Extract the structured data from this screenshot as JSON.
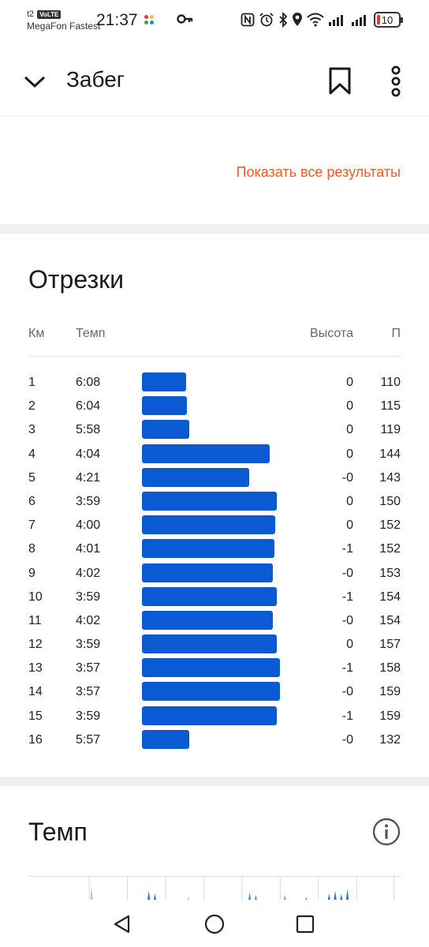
{
  "status_bar": {
    "carrier_top": "t2",
    "volte": "VoLTE",
    "carrier_bottom": "MegaFon Fastest",
    "time": "21:37",
    "battery": "10",
    "icons": [
      "nfc-icon",
      "alarm-icon",
      "bluetooth-icon",
      "location-icon",
      "wifi-icon",
      "signal-icon",
      "signal-icon",
      "battery-icon"
    ]
  },
  "header": {
    "title": "Забег",
    "icons": [
      "chevron-down-icon",
      "bookmark-icon",
      "more-vertical-icon"
    ]
  },
  "results": {
    "show_all_label": "Показать все результаты"
  },
  "splits": {
    "title": "Отрезки",
    "columns": {
      "km": "Км",
      "pace": "Темп",
      "elevation": "Высота",
      "hr": "П"
    },
    "max_bar_fraction_reference_pace_seconds": 237,
    "rows": [
      {
        "km": "1",
        "pace": "6:08",
        "elevation": "0",
        "hr": "110"
      },
      {
        "km": "2",
        "pace": "6:04",
        "elevation": "0",
        "hr": "115"
      },
      {
        "km": "3",
        "pace": "5:58",
        "elevation": "0",
        "hr": "119"
      },
      {
        "km": "4",
        "pace": "4:04",
        "elevation": "0",
        "hr": "144"
      },
      {
        "km": "5",
        "pace": "4:21",
        "elevation": "-0",
        "hr": "143"
      },
      {
        "km": "6",
        "pace": "3:59",
        "elevation": "0",
        "hr": "150"
      },
      {
        "km": "7",
        "pace": "4:00",
        "elevation": "0",
        "hr": "152"
      },
      {
        "km": "8",
        "pace": "4:01",
        "elevation": "-1",
        "hr": "152"
      },
      {
        "km": "9",
        "pace": "4:02",
        "elevation": "-0",
        "hr": "153"
      },
      {
        "km": "10",
        "pace": "3:59",
        "elevation": "-1",
        "hr": "154"
      },
      {
        "km": "11",
        "pace": "4:02",
        "elevation": "-0",
        "hr": "154"
      },
      {
        "km": "12",
        "pace": "3:59",
        "elevation": "0",
        "hr": "157"
      },
      {
        "km": "13",
        "pace": "3:57",
        "elevation": "-1",
        "hr": "158"
      },
      {
        "km": "14",
        "pace": "3:57",
        "elevation": "-0",
        "hr": "159"
      },
      {
        "km": "15",
        "pace": "3:59",
        "elevation": "-1",
        "hr": "159"
      },
      {
        "km": "16",
        "pace": "5:57",
        "elevation": "-0",
        "hr": "132"
      }
    ],
    "bar_color": "#0a5bd3"
  },
  "pace": {
    "title": "Темп",
    "icon": "info-icon"
  },
  "colors": {
    "accent": "#f15a22",
    "bar": "#0a5bd3",
    "divider": "#efefef"
  },
  "nav_bar": {
    "icons": [
      "back-triangle-icon",
      "home-circle-icon",
      "recents-square-icon"
    ]
  }
}
